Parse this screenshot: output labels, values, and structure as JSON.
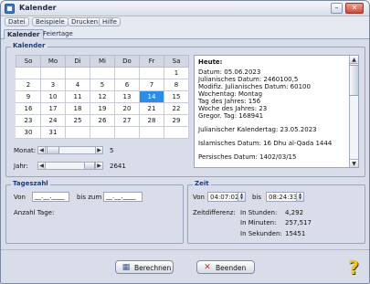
{
  "window": {
    "title": "Kalender",
    "icon": "calendar-app-icon",
    "min_glyph": "–",
    "close_glyph": "✕"
  },
  "menu": [
    "Datei",
    "Beispiele",
    "Drucken",
    "Hilfe"
  ],
  "tabs": [
    "Kalender",
    "Feiertage"
  ],
  "kalender": {
    "group_label": "Kalender",
    "weekdays": [
      "So",
      "Mo",
      "Di",
      "Mi",
      "Do",
      "Fr",
      "Sa"
    ],
    "weeks": [
      [
        "",
        "",
        "",
        "",
        "",
        "",
        "1"
      ],
      [
        "2",
        "3",
        "4",
        "5",
        "6",
        "7",
        "8"
      ],
      [
        "9",
        "10",
        "11",
        "12",
        "13",
        "14",
        "15"
      ],
      [
        "16",
        "17",
        "18",
        "19",
        "20",
        "21",
        "22"
      ],
      [
        "23",
        "24",
        "25",
        "26",
        "27",
        "28",
        "29"
      ],
      [
        "30",
        "31",
        "",
        "",
        "",
        "",
        ""
      ]
    ],
    "selected_day": "14",
    "selected_color": "#2c8de8",
    "monat_label": "Monat:",
    "monat_value": "5",
    "jahr_label": "Jahr:",
    "jahr_value": "2641"
  },
  "info": {
    "heading": "Heute:",
    "lines": [
      "Datum: 05.06.2023",
      "Julianisches Datum: 2460100,5",
      "Modifiz. Julianisches Datum: 60100",
      "Wochentag: Montag",
      "Tag des Jahres: 156",
      "Woche des Jahres: 23",
      "Gregor. Tag: 168941"
    ],
    "julian_calendar": "Julianischer Kalendertag: 23.05.2023",
    "islamic": "Islamisches Datum: 16 Dhu al-Qada 1444",
    "persian": "Persisches Datum: 1402/03/15"
  },
  "tagesanzahl": {
    "group_label": "Tageszahl",
    "von_label": "Von",
    "von_value": "__.__.____",
    "bis_label": "bis zum",
    "bis_value": "__.__.____",
    "anzahl_label": "Anzahl Tage:"
  },
  "zeit": {
    "group_label": "Zeit",
    "von_label": "Von",
    "von_value": "04:07:02",
    "bis_label": "bis",
    "bis_value": "08:24:33",
    "diff_label": "Zeitdifferenz:",
    "stunden_label": "In Stunden:",
    "stunden_value": "4,292",
    "minuten_label": "In Minuten:",
    "minuten_value": "257,517",
    "sekunden_label": "In Sekunden:",
    "sekunden_value": "15451"
  },
  "buttons": {
    "berechnen": "Berechnen",
    "berechnen_icon": "calculator-icon",
    "beenden": "Beenden",
    "beenden_icon": "red-x-icon",
    "help_glyph": "?",
    "help_icon": "help-question-icon"
  }
}
